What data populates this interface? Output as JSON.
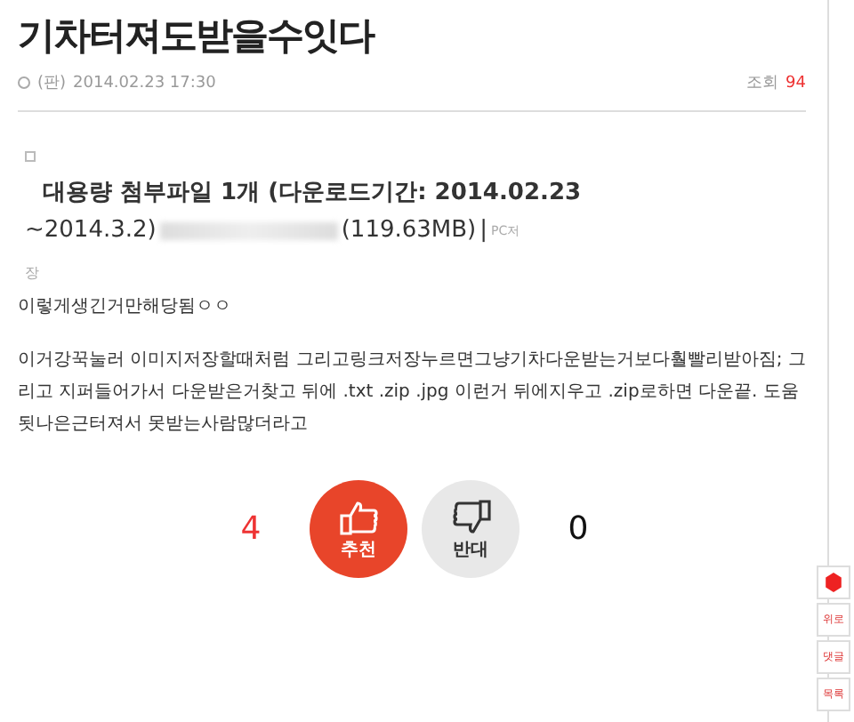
{
  "post": {
    "title": "기차터져도받을수잇다",
    "author": "(판)",
    "date": "2014.02.23 17:30",
    "views_label": "조회",
    "views": "94"
  },
  "attachment": {
    "line1": "대용량 첨부파일 1개 (다운로드기간: 2014.02.23",
    "line2_start": "~2014.3.2)",
    "size": "(119.63MB)",
    "separator": "|",
    "pc_save": "PC저",
    "pc_save_end": "장"
  },
  "body": [
    "이렇게생긴거만해당됨ㅇㅇ",
    "이거강꾹눌러 이미지저장할때처럼 그리고링크저장누르면그냥기차다운받는거보다훨빨리받아짐; 그리고 지퍼들어가서 다운받은거찾고 뒤에 .txt .zip .jpg 이런거 뒤에지우고 .zip로하면 다운끝. 도움됫나은근터져서 못받는사람많더라고"
  ],
  "votes": {
    "up_count": "4",
    "up_label": "추천",
    "down_label": "반대",
    "down_count": "0"
  },
  "side_buttons": [
    {
      "kind": "icon"
    },
    {
      "kind": "text",
      "label": "위로"
    },
    {
      "kind": "text",
      "label": "댓글"
    },
    {
      "kind": "text",
      "label": "목록"
    }
  ]
}
